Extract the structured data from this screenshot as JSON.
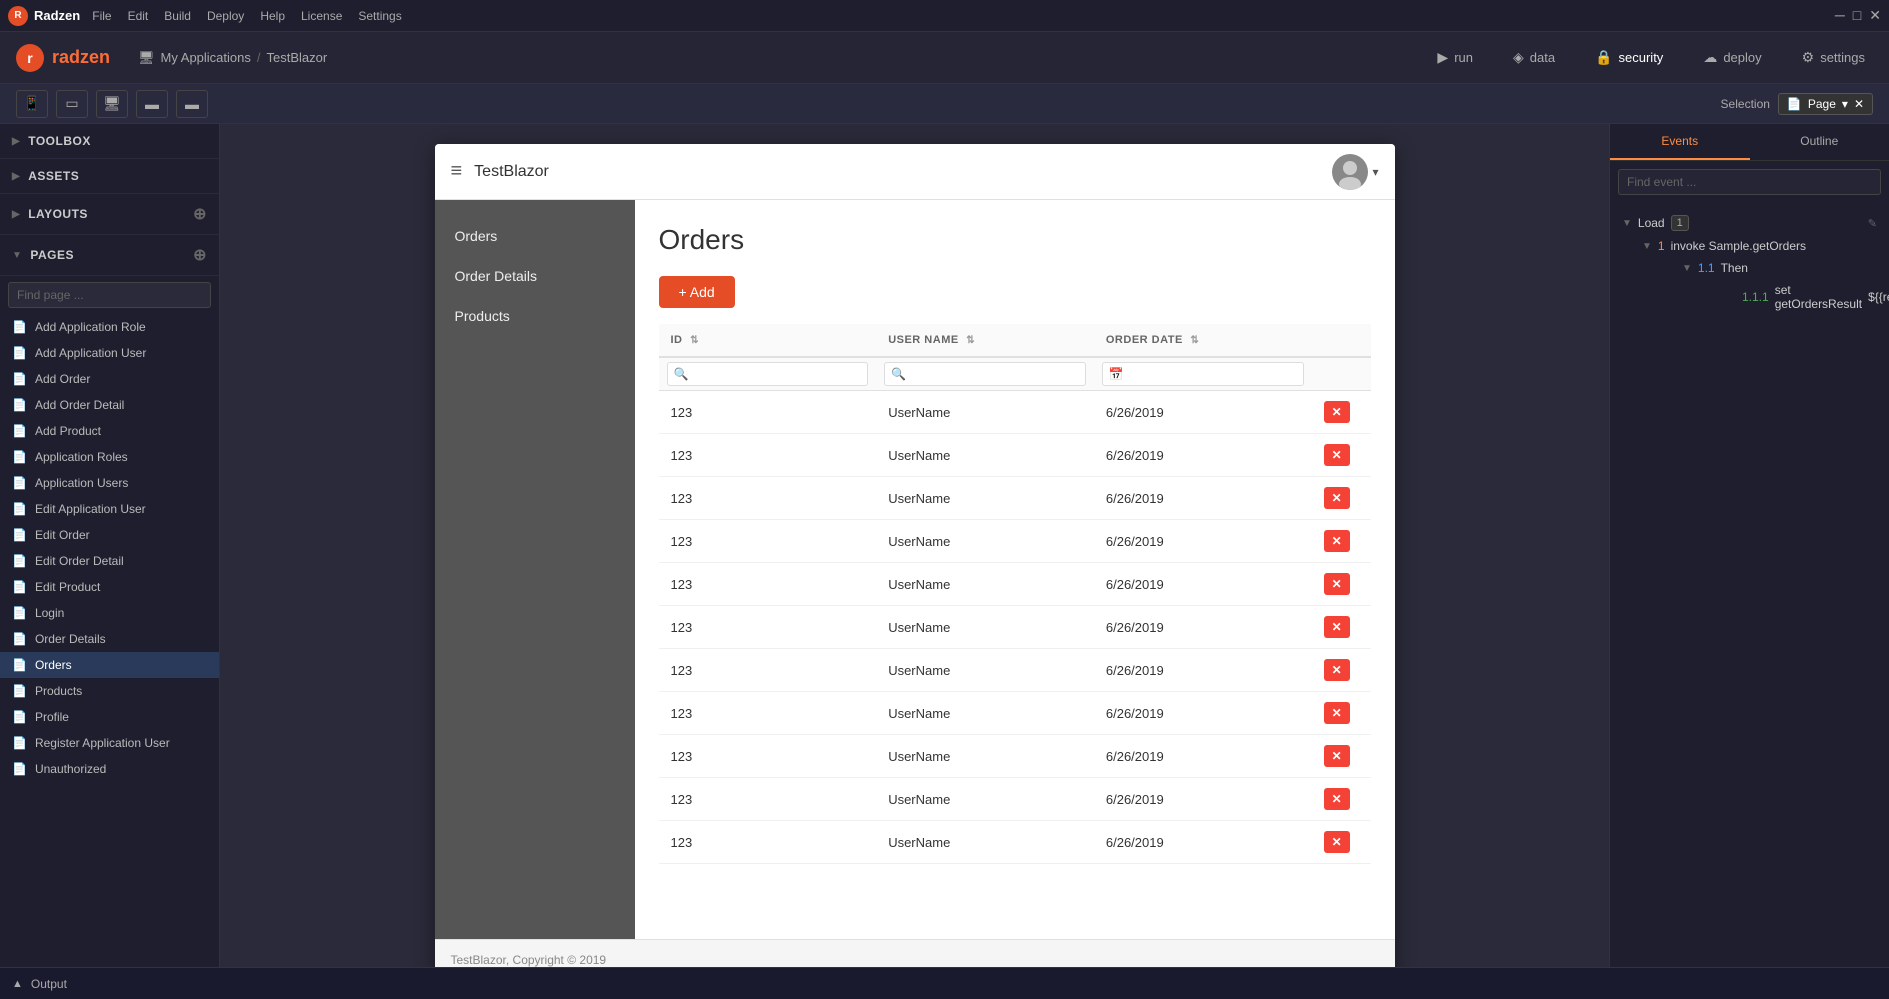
{
  "titleBar": {
    "appName": "Radzen",
    "menus": [
      "File",
      "Edit",
      "Build",
      "Deploy",
      "Help",
      "License",
      "Settings"
    ]
  },
  "mainToolbar": {
    "brand": "radzen",
    "breadcrumb": {
      "part1": "My Applications",
      "separator": "/",
      "part2": "TestBlazor"
    },
    "buttons": {
      "run": "run",
      "data": "data",
      "security": "security",
      "deploy": "deploy",
      "settings": "settings"
    }
  },
  "deviceToolbar": {
    "selectionLabel": "Selection",
    "pageSelectLabel": "Page",
    "pageSelectValue": "Page"
  },
  "sidebar": {
    "sections": {
      "toolbox": "Toolbox",
      "assets": "Assets",
      "layouts": "Layouts",
      "pages": "Pages"
    },
    "findPagePlaceholder": "Find page ...",
    "pages": [
      {
        "label": "Add Application Role",
        "active": false
      },
      {
        "label": "Add Application User",
        "active": false
      },
      {
        "label": "Add Order",
        "active": false
      },
      {
        "label": "Add Order Detail",
        "active": false
      },
      {
        "label": "Add Product",
        "active": false
      },
      {
        "label": "Application Roles",
        "active": false
      },
      {
        "label": "Application Users",
        "active": false
      },
      {
        "label": "Edit Application User",
        "active": false
      },
      {
        "label": "Edit Order",
        "active": false
      },
      {
        "label": "Edit Order Detail",
        "active": false
      },
      {
        "label": "Edit Product",
        "active": false
      },
      {
        "label": "Login",
        "active": false
      },
      {
        "label": "Order Details",
        "active": false
      },
      {
        "label": "Orders",
        "active": true
      },
      {
        "label": "Products",
        "active": false
      },
      {
        "label": "Profile",
        "active": false
      },
      {
        "label": "Register Application User",
        "active": false
      },
      {
        "label": "Unauthorized",
        "active": false
      }
    ]
  },
  "appPreview": {
    "headerTitle": "TestBlazor",
    "navItems": [
      {
        "label": "Orders",
        "active": false
      },
      {
        "label": "Order Details",
        "active": false
      },
      {
        "label": "Products",
        "active": false
      }
    ],
    "pageTitle": "Orders",
    "addButton": "+ Add",
    "table": {
      "columns": [
        {
          "header": "ID",
          "sortable": true
        },
        {
          "header": "USER NAME",
          "sortable": true
        },
        {
          "header": "ORDER DATE",
          "sortable": true
        },
        {
          "header": "",
          "sortable": false
        }
      ],
      "rows": [
        {
          "id": "123",
          "userName": "UserName",
          "orderDate": "6/26/2019"
        },
        {
          "id": "123",
          "userName": "UserName",
          "orderDate": "6/26/2019"
        },
        {
          "id": "123",
          "userName": "UserName",
          "orderDate": "6/26/2019"
        },
        {
          "id": "123",
          "userName": "UserName",
          "orderDate": "6/26/2019"
        },
        {
          "id": "123",
          "userName": "UserName",
          "orderDate": "6/26/2019"
        },
        {
          "id": "123",
          "userName": "UserName",
          "orderDate": "6/26/2019"
        },
        {
          "id": "123",
          "userName": "UserName",
          "orderDate": "6/26/2019"
        },
        {
          "id": "123",
          "userName": "UserName",
          "orderDate": "6/26/2019"
        },
        {
          "id": "123",
          "userName": "UserName",
          "orderDate": "6/26/2019"
        },
        {
          "id": "123",
          "userName": "UserName",
          "orderDate": "6/26/2019"
        },
        {
          "id": "123",
          "userName": "UserName",
          "orderDate": "6/26/2019"
        }
      ]
    },
    "footer": "TestBlazor, Copyright © 2019"
  },
  "rightPanel": {
    "tabs": [
      "Events",
      "Outline"
    ],
    "eventSearchPlaceholder": "Find event ...",
    "eventTree": {
      "load": {
        "label": "Load",
        "badge": "1",
        "child1": {
          "label": "invoke Sample.getOrders",
          "badge": "1.1 Then"
        },
        "grandchild": {
          "label": "set getOrdersResult",
          "code": "${result.value}"
        }
      }
    }
  },
  "outputBar": {
    "label": "Output"
  }
}
